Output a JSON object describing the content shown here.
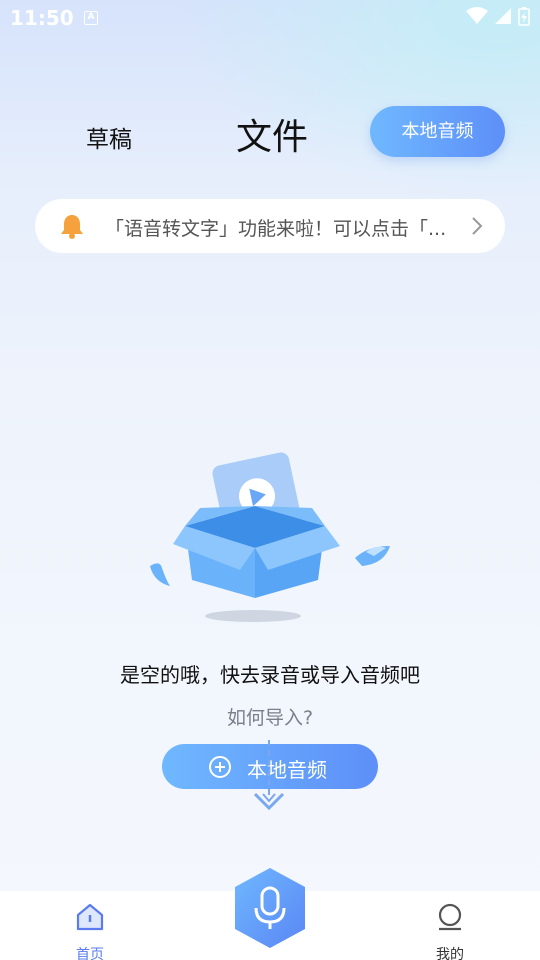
{
  "status_bar": {
    "time": "11:50",
    "notification_icon": "A",
    "icons": [
      "wifi-icon",
      "signal-icon",
      "battery-icon"
    ]
  },
  "header": {
    "tab_draft": "草稿",
    "tab_files": "文件",
    "local_audio_button": "本地音频"
  },
  "notice": {
    "icon": "bell-icon",
    "text": "「语音转文字」功能来啦！可以点击「...",
    "arrow_icon": "chevron-right-icon"
  },
  "empty_state": {
    "title": "是空的哦，快去录音或导入音频吧",
    "howto": "如何导入?",
    "import_button": "本地音频"
  },
  "bottom_nav": {
    "home_label": "首页",
    "mine_label": "我的",
    "record_icon": "microphone-icon"
  },
  "colors": {
    "accent": "#5d8ff8",
    "accent_light": "#6fb8ff",
    "notice_bell": "#f5a13c"
  }
}
